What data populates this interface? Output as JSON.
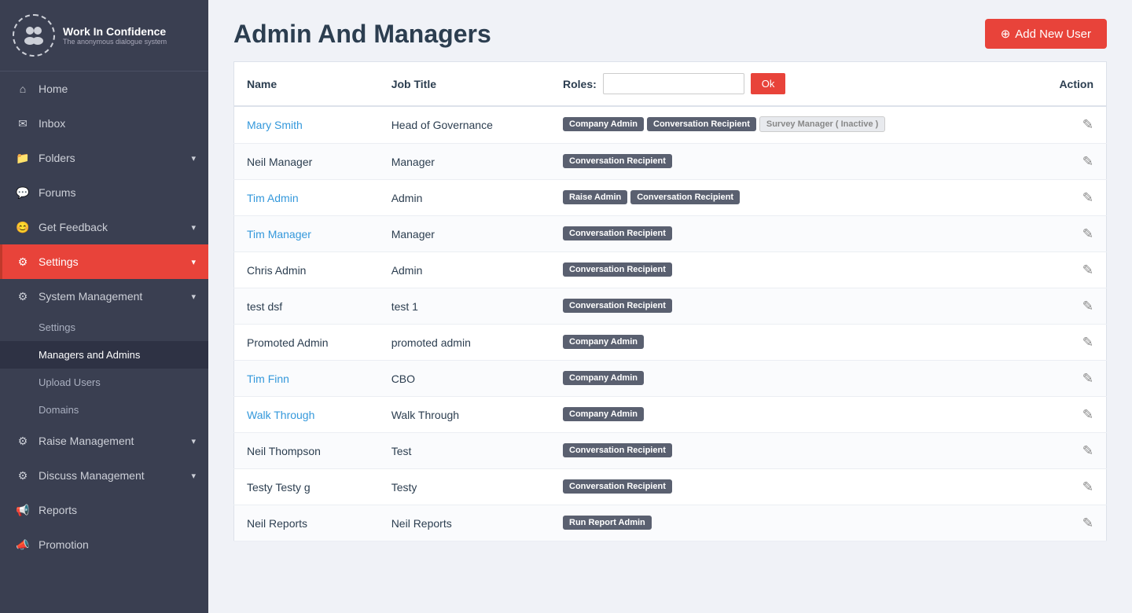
{
  "app": {
    "logo_name": "Work In Confidence",
    "logo_sub": "The anonymous dialogue system"
  },
  "sidebar": {
    "items": [
      {
        "id": "home",
        "label": "Home",
        "icon": "home",
        "active": false
      },
      {
        "id": "inbox",
        "label": "Inbox",
        "icon": "inbox",
        "active": false
      },
      {
        "id": "folders",
        "label": "Folders",
        "icon": "folder",
        "active": false,
        "hasChevron": true
      },
      {
        "id": "forums",
        "label": "Forums",
        "icon": "forum",
        "active": false
      },
      {
        "id": "get-feedback",
        "label": "Get Feedback",
        "icon": "feedback",
        "active": false,
        "hasChevron": true
      },
      {
        "id": "settings",
        "label": "Settings",
        "icon": "settings",
        "active": true,
        "hasChevron": true
      },
      {
        "id": "system-management",
        "label": "System Management",
        "icon": "gear",
        "active": false,
        "hasChevron": true
      },
      {
        "id": "raise-management",
        "label": "Raise Management",
        "icon": "raise",
        "active": false,
        "hasChevron": true
      },
      {
        "id": "discuss-management",
        "label": "Discuss Management",
        "icon": "discuss",
        "active": false,
        "hasChevron": true
      },
      {
        "id": "reports",
        "label": "Reports",
        "icon": "reports",
        "active": false
      },
      {
        "id": "promotion",
        "label": "Promotion",
        "icon": "promotion",
        "active": false
      }
    ],
    "sub_items": [
      {
        "id": "settings-sub",
        "label": "Settings",
        "active": false
      },
      {
        "id": "managers-admins",
        "label": "Managers and Admins",
        "active": true
      },
      {
        "id": "upload-users",
        "label": "Upload Users",
        "active": false
      },
      {
        "id": "domains",
        "label": "Domains",
        "active": false
      }
    ]
  },
  "page": {
    "title": "Admin And Managers",
    "add_user_label": "Add New User"
  },
  "table": {
    "columns": {
      "name": "Name",
      "job_title": "Job Title",
      "roles": "Roles:",
      "action": "Action"
    },
    "roles_filter_placeholder": "",
    "roles_ok_label": "Ok",
    "rows": [
      {
        "name": "Mary Smith",
        "name_link": true,
        "job_title": "Head of Governance",
        "roles": [
          {
            "label": "Company Admin",
            "type": "dark"
          },
          {
            "label": "Conversation Recipient",
            "type": "dark"
          },
          {
            "label": "Survey Manager ( Inactive )",
            "type": "inactive"
          }
        ]
      },
      {
        "name": "Neil Manager",
        "name_link": false,
        "job_title": "Manager",
        "roles": [
          {
            "label": "Conversation Recipient",
            "type": "dark"
          }
        ]
      },
      {
        "name": "Tim Admin",
        "name_link": true,
        "job_title": "Admin",
        "roles": [
          {
            "label": "Raise Admin",
            "type": "dark"
          },
          {
            "label": "Conversation Recipient",
            "type": "dark"
          }
        ]
      },
      {
        "name": "Tim Manager",
        "name_link": true,
        "job_title": "Manager",
        "roles": [
          {
            "label": "Conversation Recipient",
            "type": "dark"
          }
        ]
      },
      {
        "name": "Chris Admin",
        "name_link": false,
        "job_title": "Admin",
        "roles": [
          {
            "label": "Conversation Recipient",
            "type": "dark"
          }
        ]
      },
      {
        "name": "test dsf",
        "name_link": false,
        "job_title": "test 1",
        "roles": [
          {
            "label": "Conversation Recipient",
            "type": "dark"
          }
        ]
      },
      {
        "name": "Promoted Admin",
        "name_link": false,
        "job_title": "promoted admin",
        "roles": [
          {
            "label": "Company Admin",
            "type": "dark"
          }
        ]
      },
      {
        "name": "Tim Finn",
        "name_link": true,
        "job_title": "CBO",
        "roles": [
          {
            "label": "Company Admin",
            "type": "dark"
          }
        ]
      },
      {
        "name": "Walk Through",
        "name_link": true,
        "job_title": "Walk Through",
        "roles": [
          {
            "label": "Company Admin",
            "type": "dark"
          }
        ]
      },
      {
        "name": "Neil Thompson",
        "name_link": false,
        "job_title": "Test",
        "roles": [
          {
            "label": "Conversation Recipient",
            "type": "dark"
          }
        ]
      },
      {
        "name": "Testy Testy g",
        "name_link": false,
        "job_title": "Testy",
        "roles": [
          {
            "label": "Conversation Recipient",
            "type": "dark"
          }
        ]
      },
      {
        "name": "Neil Reports",
        "name_link": false,
        "job_title": "Neil Reports",
        "roles": [
          {
            "label": "Run Report Admin",
            "type": "dark"
          }
        ]
      }
    ]
  }
}
